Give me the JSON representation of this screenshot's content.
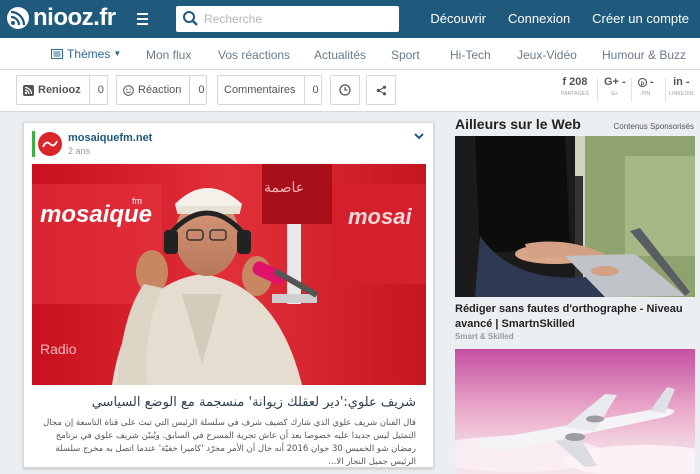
{
  "header": {
    "logo_text": "niooz.fr",
    "search_placeholder": "Recherche",
    "links": [
      "Découvrir",
      "Connexion",
      "Créer un compte"
    ]
  },
  "nav": {
    "themes_label": "Thèmes",
    "items": [
      "Mon flux",
      "Vos réactions",
      "Actualités",
      "Sport",
      "Hi-Tech",
      "Jeux-Vidéo",
      "Humour & Buzz"
    ]
  },
  "actions": {
    "renooz_label": "Reniooz",
    "renooz_count": "0",
    "reaction_label": "Réaction",
    "reaction_count": "0",
    "comments_label": "Commentaires",
    "comments_count": "0",
    "facebook_count": "208",
    "facebook_sub": "PARTAGES",
    "gplus_count": "-",
    "gplus_sub": "G+",
    "pinterest_count": "-",
    "pinterest_sub": "PIN",
    "linkedin_count": "-",
    "linkedin_sub": "LINKEDIN"
  },
  "article": {
    "source": "mosaiquefm.net",
    "time": "2 ans",
    "title": "شريف علوي:'دير لعقلك زيوانة' منسجمة مع الوضع السياسي",
    "description": "قال الفنان شريف علوي الذي شارك كضيف شرف في سلسلة الرئيس التي تبث على قناة التاسعة إن مجال التمثيل ليس جديدا عليه خصوصا بعد أن عاش تجربة المسرح في السابق. ويُبيّن شريف علوي في برنامج رمضان شو الخميس 30 جوان 2016 أنه خال أن الأمر مجرّد 'كاميرا خفيّة' عندما اتصل به مخرج سلسلة الرئيس جميل النجار الا..."
  },
  "sidebar": {
    "title": "Ailleurs sur le Web",
    "sponsored": "Contenus Sponsorisés",
    "ad1_title": "Rédiger sans fautes d'orthographe - Niveau avancé | SmartnSkilled",
    "ad1_source": "Smart & Skilled"
  },
  "colors": {
    "header_bg": "#1f5a7d",
    "accent_green": "#3fae49",
    "source_red": "#d9262c"
  }
}
